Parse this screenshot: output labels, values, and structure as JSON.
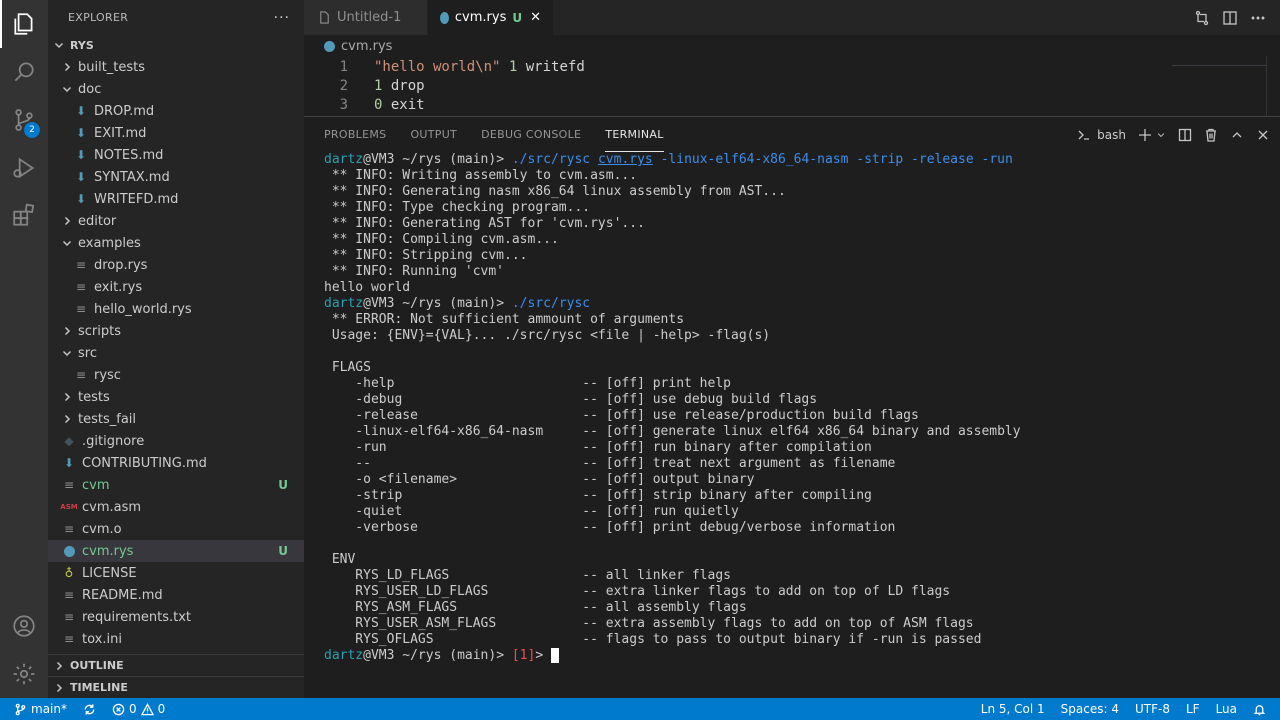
{
  "activity_bar": {
    "badge": "2"
  },
  "sidebar": {
    "title": "EXPLORER",
    "more": "···",
    "root": "RYS",
    "tree": [
      {
        "label": "built_tests",
        "type": "folder",
        "open": false,
        "depth": 1
      },
      {
        "label": "doc",
        "type": "folder",
        "open": true,
        "depth": 1
      },
      {
        "label": "DROP.md",
        "type": "md",
        "depth": 2
      },
      {
        "label": "EXIT.md",
        "type": "md",
        "depth": 2
      },
      {
        "label": "NOTES.md",
        "type": "md",
        "depth": 2
      },
      {
        "label": "SYNTAX.md",
        "type": "md",
        "depth": 2
      },
      {
        "label": "WRITEFD.md",
        "type": "md",
        "depth": 2
      },
      {
        "label": "editor",
        "type": "folder",
        "open": false,
        "depth": 1
      },
      {
        "label": "examples",
        "type": "folder",
        "open": true,
        "depth": 1
      },
      {
        "label": "drop.rys",
        "type": "text",
        "depth": 2
      },
      {
        "label": "exit.rys",
        "type": "text",
        "depth": 2
      },
      {
        "label": "hello_world.rys",
        "type": "text",
        "depth": 2
      },
      {
        "label": "scripts",
        "type": "folder",
        "open": false,
        "depth": 1
      },
      {
        "label": "src",
        "type": "folder",
        "open": true,
        "depth": 1
      },
      {
        "label": "rysc",
        "type": "text",
        "depth": 2
      },
      {
        "label": "tests",
        "type": "folder",
        "open": false,
        "depth": 1
      },
      {
        "label": "tests_fail",
        "type": "folder",
        "open": false,
        "depth": 1
      },
      {
        "label": ".gitignore",
        "type": "git",
        "depth": 1
      },
      {
        "label": "CONTRIBUTING.md",
        "type": "md",
        "depth": 1
      },
      {
        "label": "cvm",
        "type": "text",
        "depth": 1,
        "status": "U"
      },
      {
        "label": "cvm.asm",
        "type": "asm",
        "depth": 1
      },
      {
        "label": "cvm.o",
        "type": "text",
        "depth": 1
      },
      {
        "label": "cvm.rys",
        "type": "rys",
        "depth": 1,
        "status": "U",
        "selected": true
      },
      {
        "label": "LICENSE",
        "type": "license",
        "depth": 1
      },
      {
        "label": "README.md",
        "type": "text",
        "depth": 1
      },
      {
        "label": "requirements.txt",
        "type": "text",
        "depth": 1
      },
      {
        "label": "tox.ini",
        "type": "text",
        "depth": 1
      }
    ],
    "outline": "OUTLINE",
    "timeline": "TIMELINE"
  },
  "tabs": [
    {
      "label": "Untitled-1",
      "active": false
    },
    {
      "label": "cvm.rys",
      "active": true,
      "status": "U",
      "close": "✕"
    }
  ],
  "editor": {
    "breadcrumb": "cvm.rys",
    "lines": [
      {
        "n": "1",
        "str": "\"hello world\\n\"",
        "num": "1",
        "rest": " writefd"
      },
      {
        "n": "2",
        "str": "",
        "num": "1",
        "rest": " drop"
      },
      {
        "n": "3",
        "str": "",
        "num": "0",
        "rest": " exit"
      }
    ]
  },
  "panel": {
    "tabs": [
      "PROBLEMS",
      "OUTPUT",
      "DEBUG CONSOLE",
      "TERMINAL"
    ],
    "active_tab": "TERMINAL",
    "shell": "bash"
  },
  "terminal": {
    "prompt_user": "dartz",
    "prompt_host": "@VM3",
    "prompt_path": " ~/rys (main)> ",
    "cmd1": "./src/rysc",
    "cmd1_file": "cvm.rys",
    "cmd1_args": "-linux-elf64-x86_64-nasm -strip -release -run",
    "info_lines": [
      " ** INFO: Writing assembly to cvm.asm...",
      " ** INFO: Generating nasm x86_64 linux assembly from AST...",
      " ** INFO: Type checking program...",
      " ** INFO: Generating AST for 'cvm.rys'...",
      " ** INFO: Compiling cvm.asm...",
      " ** INFO: Stripping cvm...",
      " ** INFO: Running 'cvm'"
    ],
    "program_output": "hello world",
    "cmd2": "./src/rysc",
    "usage_lines": [
      " ** ERROR: Not sufficient ammount of arguments",
      " Usage: {ENV}={VAL}... ./src/rysc <file | -help> -flag(s)",
      "",
      " FLAGS",
      "    -help                        -- [off] print help",
      "    -debug                       -- [off] use debug build flags",
      "    -release                     -- [off] use release/production build flags",
      "    -linux-elf64-x86_64-nasm     -- [off] generate linux elf64 x86_64 binary and assembly",
      "    -run                         -- [off] run binary after compilation",
      "    --                           -- [off] treat next argument as filename",
      "    -o <filename>                -- [off] output binary",
      "    -strip                       -- [off] strip binary after compiling",
      "    -quiet                       -- [off] run quietly",
      "    -verbose                     -- [off] print debug/verbose information",
      "",
      " ENV",
      "    RYS_LD_FLAGS                 -- all linker flags",
      "    RYS_USER_LD_FLAGS            -- extra linker flags to add on top of LD flags",
      "    RYS_ASM_FLAGS                -- all assembly flags",
      "    RYS_USER_ASM_FLAGS           -- extra assembly flags to add on top of ASM flags",
      "    RYS_OFLAGS                   -- flags to pass to output binary if -run is passed"
    ],
    "exit_code": "[1]",
    "final_prompt_tail": "> "
  },
  "statusbar": {
    "branch": "main*",
    "errors": "0",
    "warnings": "0",
    "position": "Ln 5, Col 1",
    "spaces": "Spaces: 4",
    "encoding": "UTF-8",
    "eol": "LF",
    "language": "Lua"
  },
  "colors": {
    "accent": "#007acc",
    "untracked": "#73c991",
    "terminal_user": "#2aa1b3",
    "terminal_cmd": "#3b8eea",
    "error": "#f14c4c"
  }
}
